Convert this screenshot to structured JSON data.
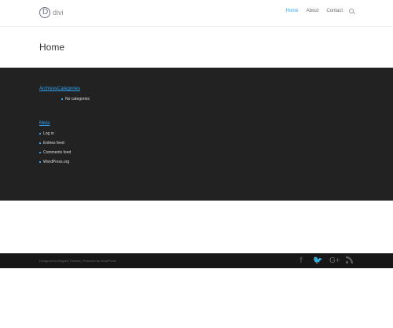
{
  "header": {
    "logo_letter": "D",
    "logo_text": "divi",
    "nav": {
      "home": "Home",
      "about": "About",
      "contact": "Contact"
    }
  },
  "main": {
    "page_title": "Home"
  },
  "footer": {
    "archives_categories_title": "ArchivesCategories",
    "categories_items": [
      "No categories"
    ],
    "meta_title": "Meta",
    "meta_items": [
      "Log in",
      "Entries feed",
      "Comments feed",
      "WordPress.org"
    ],
    "credits": "Designed by Elegant Themes | Powered by WordPress"
  },
  "social": {
    "facebook": "f",
    "twitter": "🐦",
    "google_plus": "G+"
  },
  "colors": {
    "accent": "#2ea3f2",
    "footer_bg": "#222222",
    "bottom_bar_bg": "#171717"
  },
  "icons": [
    "search-icon",
    "facebook-icon",
    "twitter-icon",
    "google-plus-icon",
    "rss-icon"
  ]
}
